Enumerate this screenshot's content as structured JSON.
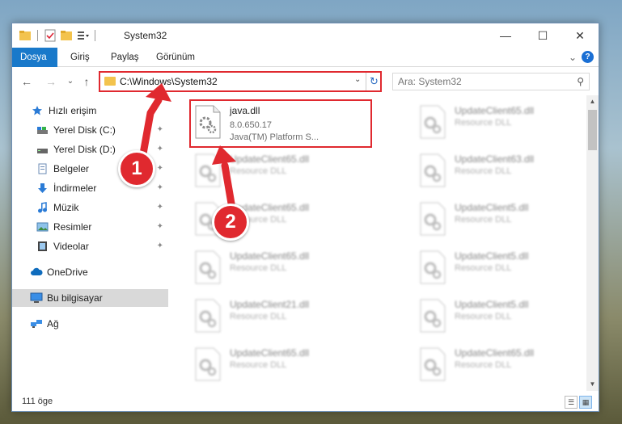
{
  "window": {
    "title": "System32",
    "controls": {
      "minimize": "—",
      "maximize": "☐",
      "close": "✕"
    }
  },
  "ribbon": {
    "tabs": [
      {
        "label": "Dosya",
        "active": true
      },
      {
        "label": "Giriş"
      },
      {
        "label": "Paylaş"
      },
      {
        "label": "Görünüm"
      }
    ],
    "collapse_glyph": "⌄",
    "help_glyph": "?"
  },
  "nav": {
    "back": "←",
    "forward": "→",
    "recent": "⌄",
    "up": "↑",
    "address": "C:\\Windows\\System32",
    "address_dropdown": "⌄",
    "refresh": "↻",
    "search_placeholder": "Ara: System32",
    "search_glyph": "⚲"
  },
  "sidebar": {
    "items": [
      {
        "label": "Hızlı erişim",
        "icon": "star-icon",
        "pinned": false
      },
      {
        "label": "Yerel Disk (C:)",
        "icon": "drive-icon",
        "pinned": true
      },
      {
        "label": "Yerel Disk (D:)",
        "icon": "drive-icon",
        "pinned": true
      },
      {
        "label": "Belgeler",
        "icon": "documents-icon",
        "pinned": true
      },
      {
        "label": "İndirmeler",
        "icon": "download-icon",
        "pinned": true
      },
      {
        "label": "Müzik",
        "icon": "music-icon",
        "pinned": true
      },
      {
        "label": "Resimler",
        "icon": "pictures-icon",
        "pinned": true
      },
      {
        "label": "Videolar",
        "icon": "videos-icon",
        "pinned": true
      },
      {
        "label": "OneDrive",
        "icon": "cloud-icon",
        "pinned": false
      },
      {
        "label": "Bu bilgisayar",
        "icon": "computer-icon",
        "pinned": false,
        "selected": true
      },
      {
        "label": "Ağ",
        "icon": "network-icon",
        "pinned": false
      }
    ],
    "pin_glyph": "📌"
  },
  "files": {
    "highlighted": {
      "name": "java.dll",
      "version": "8.0.650.17",
      "description": "Java(TM) Platform S..."
    },
    "blurred": [
      {
        "name": "UpdateClient65.dll",
        "type": "Resource DLL"
      },
      {
        "name": "UpdateClient65.dll",
        "type": "Resource DLL"
      },
      {
        "name": "UpdateClient63.dll",
        "type": "Resource DLL"
      },
      {
        "name": "UpdateClient65.dll",
        "type": "Resource DLL"
      },
      {
        "name": "UpdateClient5.dll",
        "type": "Resource DLL"
      },
      {
        "name": "UpdateClient65.dll",
        "type": "Resource DLL"
      },
      {
        "name": "UpdateClient5.dll",
        "type": "Resource DLL"
      },
      {
        "name": "UpdateClient21.dll",
        "type": "Resource DLL"
      },
      {
        "name": "UpdateClient5.dll",
        "type": "Resource DLL"
      },
      {
        "name": "UpdateClient65.dll",
        "type": "Resource DLL"
      },
      {
        "name": "UpdateClient65.dll",
        "type": "Resource DLL"
      },
      {
        "name": "UpdateClient65.dll",
        "type": "Resource DLL"
      }
    ]
  },
  "annotations": {
    "badge1": "1",
    "badge2": "2",
    "color": "#e0292f"
  },
  "status": {
    "count": "111 öge"
  },
  "colors": {
    "accent": "#1979ca",
    "highlight": "#e0292f",
    "folder": "#f3c34d"
  }
}
